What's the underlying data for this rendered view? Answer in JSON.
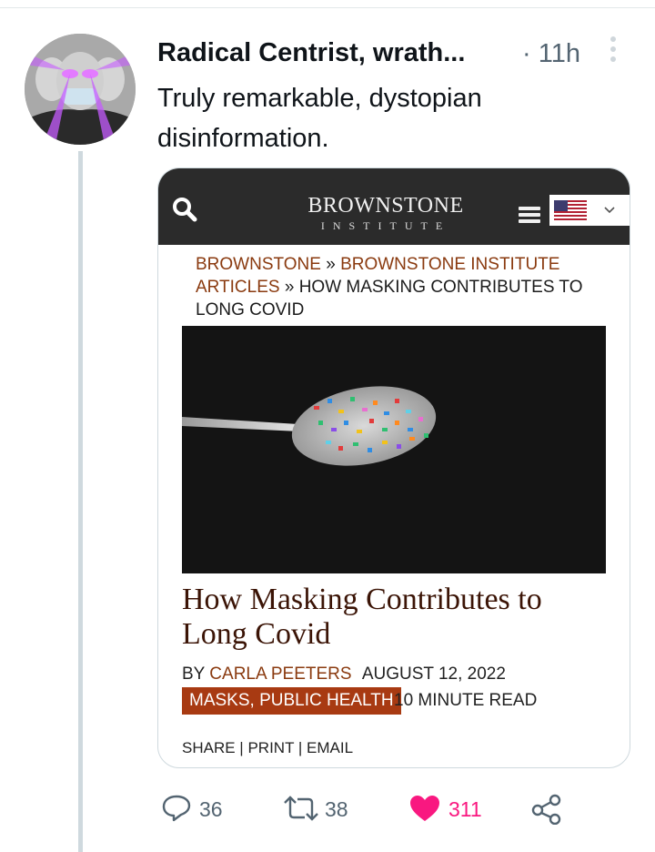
{
  "tweet": {
    "author_name": "Radical Centrist, wrath...",
    "time": "· 11h",
    "text": "Truly remarkable, dystopian disinformation."
  },
  "card": {
    "site_name": "BROWNSTONE",
    "site_tagline": "INSTITUTE",
    "breadcrumb": {
      "item1": "BROWNSTONE",
      "sep1": " » ",
      "item2": "BROWNSTONE INSTITUTE ARTICLES",
      "sep2": " » ",
      "current": "HOW MASKING CONTRIBUTES TO LONG COVID"
    },
    "article_title": "How Masking Contributes to Long Covid",
    "byline_prefix": "BY",
    "author": "CARLA PEETERS",
    "date": "AUGUST 12, 2022",
    "tags": "MASKS, PUBLIC HEALTH",
    "read_time": "10 MINUTE READ",
    "share": "SHARE",
    "print": "PRINT",
    "email": "EMAIL"
  },
  "actions": {
    "replies": "36",
    "retweets": "38",
    "likes": "311"
  },
  "icons": {
    "reply": "speech-bubble-icon",
    "retweet": "retweet-arrows-icon",
    "like": "heart-icon",
    "share": "share-nodes-icon",
    "search": "magnifier-icon",
    "menu": "hamburger-menu-icon"
  },
  "colors": {
    "like": "#f91880",
    "link": "#8a3a0f",
    "tag_bg": "#a83a12",
    "header_bg": "#2b2b2b",
    "title": "#3b1406"
  }
}
